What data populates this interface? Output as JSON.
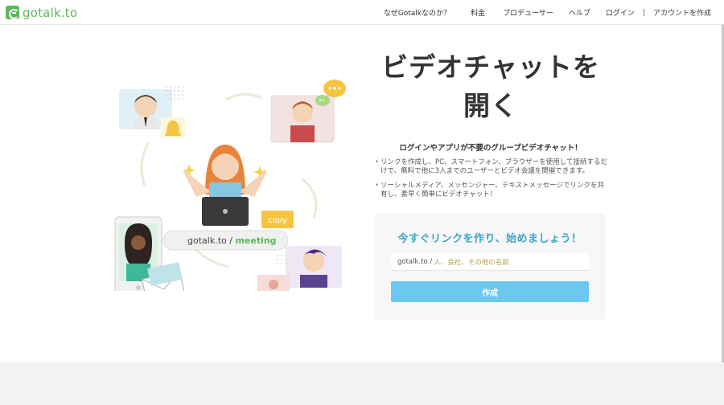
{
  "brand": {
    "name": "gotalk.to",
    "color": "#5cb85c"
  },
  "nav": {
    "why": "なぜGotalkなのか？",
    "pricing": "料金",
    "producer": "プロデューサー",
    "help": "ヘルプ",
    "login": "ログイン",
    "separator": "|",
    "signup": "アカウントを作成"
  },
  "hero": {
    "title": "ビデオチャットを開く",
    "subtitle": "ログインやアプリが不要のグループビデオチャット！",
    "bullets": [
      "リンクを作成し、PC、スマートフォン、ブラウザーを使用して接続するだけで、無料で他に3人までのユーザーとビデオ会議を開催できます。",
      "ソーシャルメディア、メッセンジャー、テキストメッセージでリンクを共有し、素早く簡単にビデオチャット！"
    ]
  },
  "card": {
    "title": "今すぐリンクを作り、始めましょう！",
    "input_prefix": "gotalk.to /",
    "input_placeholder": "人、会社、その他の名前",
    "button_label": "作成",
    "accent": "#3aa6c4",
    "button_color": "#6cc8ee"
  },
  "illustration": {
    "url_domain": "gotalk.to /",
    "url_path": "meeting",
    "copy_label": "copy"
  }
}
